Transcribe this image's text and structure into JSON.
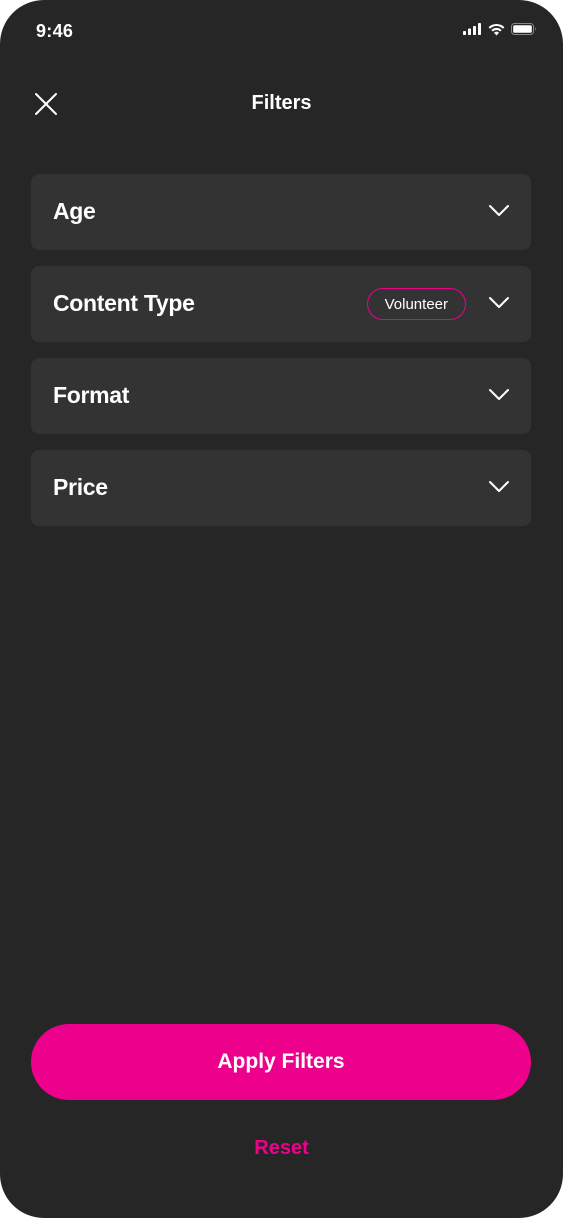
{
  "status_bar": {
    "time": "9:46",
    "icons": [
      "cellular-signal-icon",
      "wifi-icon",
      "battery-icon"
    ]
  },
  "header": {
    "title": "Filters",
    "close_icon": "close-icon"
  },
  "filters": [
    {
      "label": "Age",
      "selected_chip": null,
      "icon": "chevron-down-icon"
    },
    {
      "label": "Content Type",
      "selected_chip": "Volunteer",
      "icon": "chevron-down-icon"
    },
    {
      "label": "Format",
      "selected_chip": null,
      "icon": "chevron-down-icon"
    },
    {
      "label": "Price",
      "selected_chip": null,
      "icon": "chevron-down-icon"
    }
  ],
  "actions": {
    "apply_label": "Apply Filters",
    "reset_label": "Reset"
  },
  "colors": {
    "background": "#262626",
    "card": "#333333",
    "accent": "#ec008c",
    "text": "#ffffff"
  }
}
